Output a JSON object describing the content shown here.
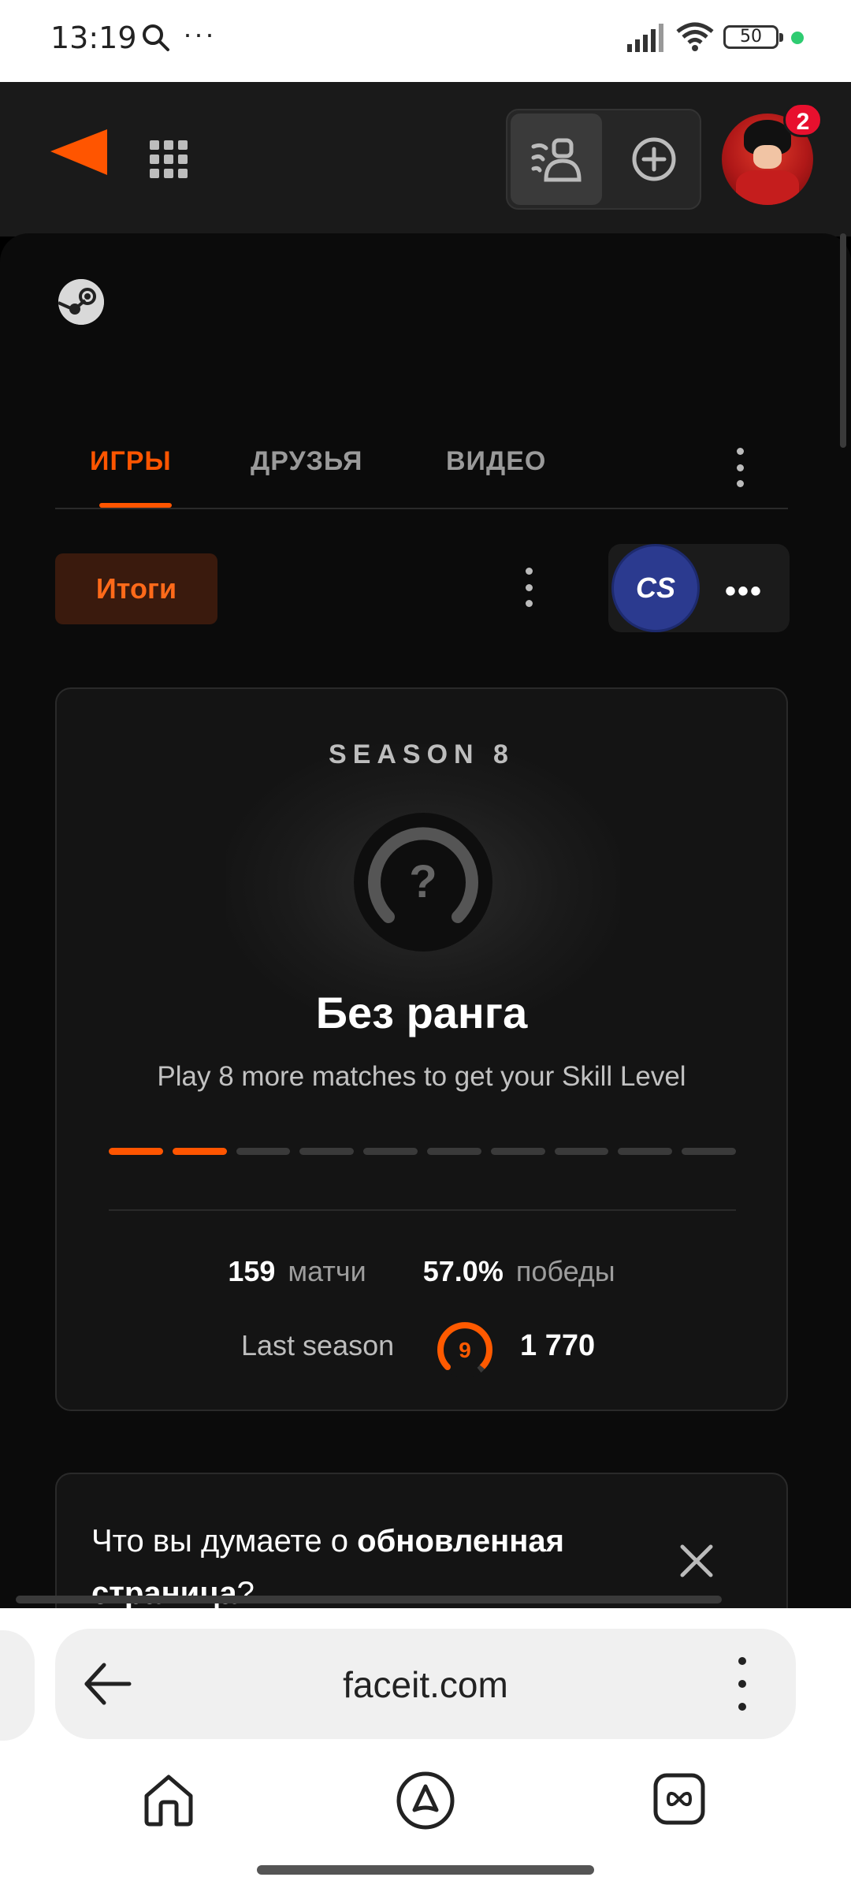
{
  "status_bar": {
    "time": "13:19",
    "battery": "50",
    "indicator_color": "#2ecc71"
  },
  "header": {
    "logo": "faceit-logo",
    "notifications_count": "2",
    "brand_color": "#ff5500"
  },
  "tabs": [
    {
      "label": "ИГРЫ",
      "active": true
    },
    {
      "label": "ДРУЗЬЯ",
      "active": false
    },
    {
      "label": "ВИДЕО",
      "active": false
    }
  ],
  "toolbar": {
    "summary_label": "Итоги",
    "game_logo_text": "CS",
    "game_more": "•••"
  },
  "rank_card": {
    "season": "SEASON 8",
    "rank_symbol": "?",
    "title": "Без ранга",
    "subtitle": "Play 8 more matches to get your Skill Level",
    "progress_filled": 2,
    "progress_total": 10,
    "matches_value": "159",
    "matches_label": "матчи",
    "winrate_value": "57.0%",
    "winrate_label": "победы",
    "last_season_label": "Last season",
    "last_level": "9",
    "last_elo": "1 770"
  },
  "feedback": {
    "question_prefix": "Что вы думаете о ",
    "question_bold": "обновленная страница",
    "question_suffix": "?"
  },
  "browser": {
    "url": "faceit.com"
  }
}
